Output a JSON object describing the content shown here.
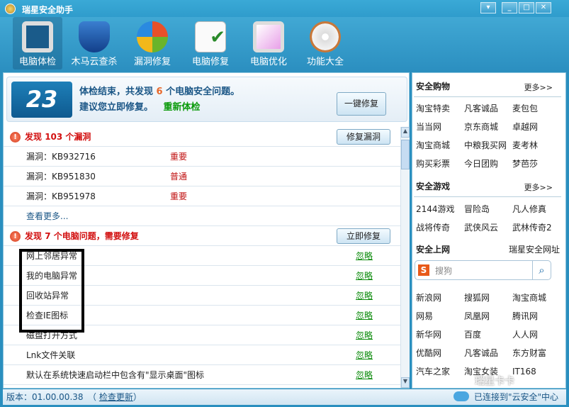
{
  "window": {
    "title": "瑞星安全助手",
    "min": "▾",
    "minimize": "_",
    "maximize": "□",
    "close": "✕"
  },
  "toolbar": [
    {
      "label": "电脑体检",
      "icon": "monitor-pulse-icon",
      "active": true
    },
    {
      "label": "木马云查杀",
      "icon": "shield-icon"
    },
    {
      "label": "漏洞修复",
      "icon": "windows-update-icon"
    },
    {
      "label": "电脑修复",
      "icon": "checklist-icon"
    },
    {
      "label": "电脑优化",
      "icon": "magic-wand-monitor-icon"
    },
    {
      "label": "功能大全",
      "icon": "disc-box-icon"
    }
  ],
  "summary": {
    "score": "23",
    "line1_a": "体检结束，共发现 ",
    "line1_count": "6",
    "line1_b": " 个电脑安全问题。",
    "line2": "建议您立即修复。",
    "recheck": "重新体检",
    "fix_all": "一键修复"
  },
  "vuln": {
    "title": "发现 ",
    "count": "103",
    "title_b": " 个漏洞",
    "button": "修复漏洞",
    "items": [
      {
        "name": "漏洞：KB932716",
        "level": "重要"
      },
      {
        "name": "漏洞：KB951830",
        "level": "普通"
      },
      {
        "name": "漏洞：KB951978",
        "level": "重要"
      }
    ],
    "more": "查看更多..."
  },
  "problems": {
    "title": "发现 ",
    "count": "7",
    "title_b": " 个电脑问题，需要修复",
    "button": "立即修复",
    "ignore": "忽略",
    "items": [
      "网上邻居异常",
      "我的电脑异常",
      "回收站异常",
      "检查IE图标",
      "磁盘打开方式",
      "Lnk文件关联",
      "默认在系统快速启动栏中包含有\"显示桌面\"图标"
    ]
  },
  "sidebar": {
    "shopping": {
      "title": "安全购物",
      "more": "更多>>",
      "links": [
        "淘宝特卖",
        "凡客诚品",
        "麦包包",
        "当当网",
        "京东商城",
        "卓越网",
        "淘宝商城",
        "中粮我买网",
        "麦考林",
        "购买彩票",
        "今日团购",
        "梦芭莎"
      ]
    },
    "games": {
      "title": "安全游戏",
      "more": "更多>>",
      "links": [
        "2144游戏",
        "冒险岛",
        "凡人修真",
        "战将传奇",
        "武侠风云",
        "武林传奇2"
      ]
    },
    "web": {
      "title": "安全上网",
      "more": "瑞星安全网址",
      "search_placeholder": "搜狗",
      "search_logo": "S",
      "links": [
        "新浪网",
        "搜狐网",
        "淘宝商城",
        "网易",
        "凤凰网",
        "腾讯网",
        "新华网",
        "百度",
        "人人网",
        "优酷网",
        "凡客诚品",
        "东方财富",
        "汽车之家",
        "淘宝女装",
        "IT168"
      ]
    }
  },
  "status": {
    "version": "版本：01.00.00.38",
    "update_open": "（ ",
    "update": "检查更新",
    "update_close": "）",
    "cloud": "已连接到\"云安全\"中心",
    "watermark": "瑞星卡卡"
  }
}
